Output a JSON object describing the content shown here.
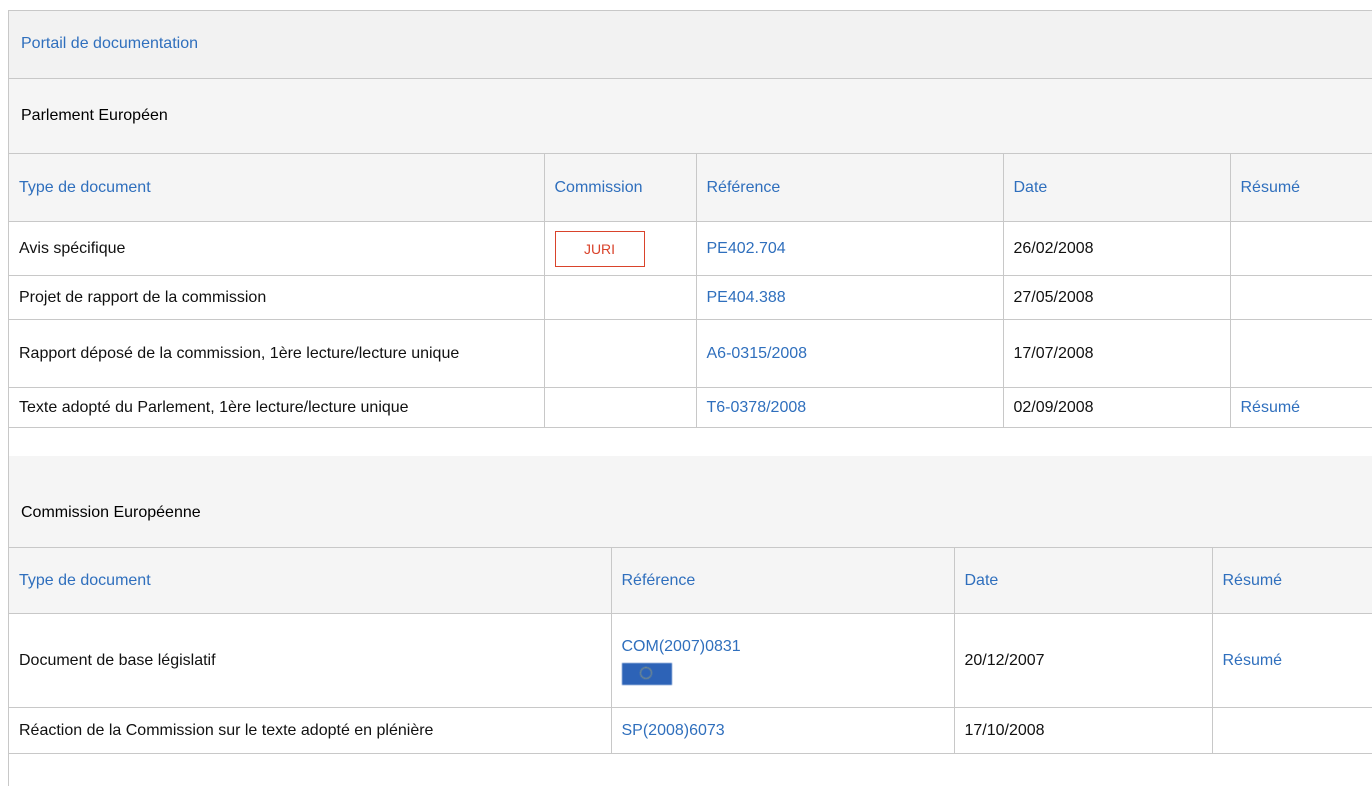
{
  "portal": {
    "title": "Portail de documentation"
  },
  "parliament": {
    "title": "Parlement Européen",
    "headers": {
      "type": "Type de document",
      "committee": "Commission",
      "reference": "Référence",
      "date": "Date",
      "summary": "Résumé"
    },
    "rows": [
      {
        "type": "Avis spécifique",
        "committee": "JURI",
        "reference": "PE402.704",
        "date": "26/02/2008",
        "summary": ""
      },
      {
        "type": "Projet de rapport de la commission",
        "committee": "",
        "reference": "PE404.388",
        "date": "27/05/2008",
        "summary": ""
      },
      {
        "type": "Rapport déposé de la commission, 1ère lecture/lecture unique",
        "committee": "",
        "reference": "A6-0315/2008",
        "date": "17/07/2008",
        "summary": ""
      },
      {
        "type": "Texte adopté du Parlement, 1ère lecture/lecture unique",
        "committee": "",
        "reference": "T6-0378/2008",
        "date": "02/09/2008",
        "summary": "Résumé"
      }
    ]
  },
  "commission": {
    "title": "Commission Européenne",
    "headers": {
      "type": "Type de document",
      "reference": "Référence",
      "date": "Date",
      "summary": "Résumé"
    },
    "rows": [
      {
        "type": "Document de base législatif",
        "reference": "COM(2007)0831",
        "date": "20/12/2007",
        "summary": "Résumé"
      },
      {
        "type": "Réaction de la Commission sur le texte adopté en plénière",
        "reference": "SP(2008)6073",
        "date": "17/10/2008",
        "summary": ""
      }
    ]
  },
  "icons": {
    "eu_flag": "eu-flag-icon"
  },
  "colors": {
    "link": "#2f6fbd",
    "badge": "#d9432b",
    "header_bg": "#f5f5f5",
    "border": "#c8c8c8"
  }
}
